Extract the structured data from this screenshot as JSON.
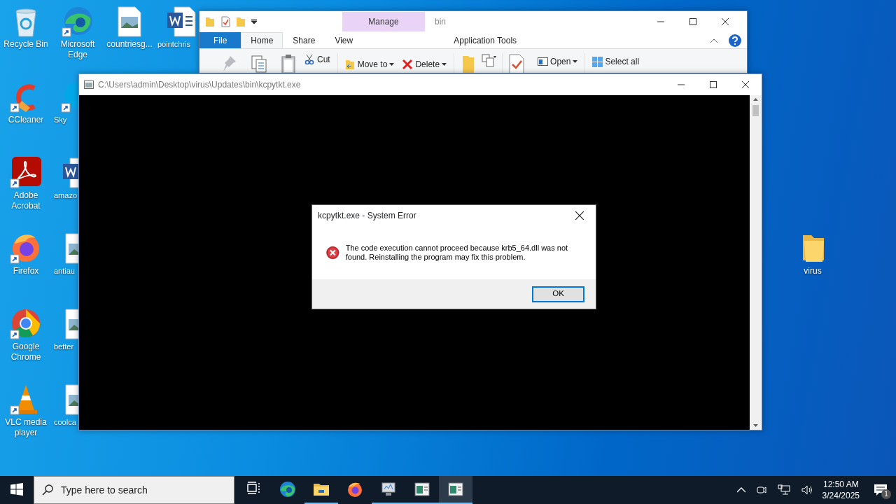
{
  "desktop_columns": [
    [
      {
        "label": "Recycle Bin",
        "kind": "recycle",
        "shortcut": false,
        "cut": false
      },
      {
        "label": "CCleaner",
        "kind": "ccleaner",
        "shortcut": true,
        "cut": false
      },
      {
        "label": "Adobe Acrobat",
        "kind": "acrobat",
        "shortcut": true,
        "cut": false
      },
      {
        "label": "Firefox",
        "kind": "firefox",
        "shortcut": true,
        "cut": false
      },
      {
        "label": "Google Chrome",
        "kind": "chrome",
        "shortcut": true,
        "cut": false
      },
      {
        "label": "VLC media player",
        "kind": "vlc",
        "shortcut": true,
        "cut": false
      }
    ],
    [
      {
        "label": "Microsoft Edge",
        "kind": "edge",
        "shortcut": true,
        "cut": false
      },
      {
        "label": "Sky",
        "kind": "skype",
        "shortcut": true,
        "cut": true
      },
      {
        "label": "amazo",
        "kind": "word",
        "shortcut": false,
        "cut": true
      },
      {
        "label": "antiau",
        "kind": "image",
        "shortcut": false,
        "cut": true
      },
      {
        "label": "better",
        "kind": "image",
        "shortcut": false,
        "cut": true
      },
      {
        "label": "coolca",
        "kind": "image",
        "shortcut": false,
        "cut": true
      }
    ],
    [
      {
        "label": "countriesg...",
        "kind": "image",
        "shortcut": false,
        "cut": false
      }
    ],
    [
      {
        "label": "pointchris",
        "kind": "word",
        "shortcut": false,
        "cut": true
      }
    ]
  ],
  "right_icons": [
    {
      "label": "virus",
      "kind": "folder",
      "shortcut": false,
      "cut": false
    }
  ],
  "explorer": {
    "title": "bin",
    "context_header": "Manage",
    "tabs": [
      {
        "label": "File",
        "kind": "file",
        "selected": false
      },
      {
        "label": "Home",
        "kind": "plain",
        "selected": true
      },
      {
        "label": "Share",
        "kind": "plain",
        "selected": false
      },
      {
        "label": "View",
        "kind": "plain",
        "selected": false
      },
      {
        "label": "Application Tools",
        "kind": "context",
        "selected": false
      }
    ],
    "ribbon": [
      {
        "label": "Cut",
        "kind": "cut",
        "dropdown": false
      },
      {
        "label": "Move to",
        "kind": "move",
        "dropdown": true
      },
      {
        "label": "Delete",
        "kind": "delete",
        "dropdown": true
      },
      {
        "label": "Open",
        "kind": "open",
        "dropdown": true
      },
      {
        "label": "Select all",
        "kind": "select",
        "dropdown": false
      }
    ]
  },
  "console": {
    "title": "C:\\Users\\admin\\Desktop\\virus\\Updates\\bin\\kcpytkt.exe"
  },
  "dialog": {
    "title": "kcpytkt.exe - System Error",
    "message": "The code execution cannot proceed because krb5_64.dll was not found. Reinstalling the program may fix this problem.",
    "button": "OK"
  },
  "taskbar": {
    "search_placeholder": "Type here to search",
    "apps": [
      {
        "kind": "taskview",
        "running": false,
        "selected": false
      },
      {
        "kind": "edge",
        "running": false,
        "selected": false
      },
      {
        "kind": "explorer",
        "running": true,
        "selected": false
      },
      {
        "kind": "firefox",
        "running": false,
        "selected": false
      },
      {
        "kind": "monitor",
        "running": true,
        "selected": false
      },
      {
        "kind": "window",
        "running": true,
        "selected": false
      },
      {
        "kind": "window",
        "running": true,
        "selected": true
      }
    ],
    "time": "12:50 AM",
    "date": "3/24/2025",
    "notifications": "1"
  }
}
